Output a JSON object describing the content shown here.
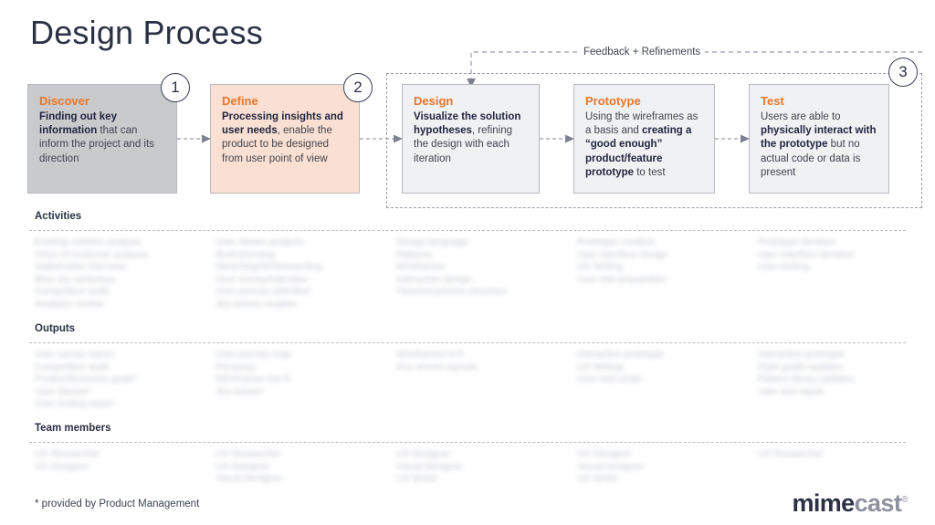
{
  "title": "Design Process",
  "feedback": {
    "label": "Feedback + Refinements"
  },
  "steps": [
    {
      "number": "1"
    },
    {
      "number": "2"
    },
    {
      "number": "3"
    }
  ],
  "phases": [
    {
      "id": "discover",
      "title": "Discover",
      "desc_bold": "Finding out key information",
      "desc_rest": " that can inform the project and its direction",
      "bg_color": "#c9cacc"
    },
    {
      "id": "define",
      "title": "Define",
      "desc_bold": "Processing insights and user needs",
      "desc_rest": ", enable the product to be designed from user point of view",
      "bg_color": "#fae0d2"
    },
    {
      "id": "design",
      "title": "Design",
      "desc_bold": "Visualize the solution hypotheses",
      "desc_rest": ", refining the design with each iteration",
      "bg_color": "#f0f1f2"
    },
    {
      "id": "prototype",
      "title": "Prototype",
      "desc_lead": "Using the wireframes as a basis and ",
      "desc_bold": "creating a “good enough” product/feature prototype",
      "desc_rest": " to test",
      "bg_color": "#f0f1f2"
    },
    {
      "id": "test",
      "title": "Test",
      "desc_lead": "Users are able to ",
      "desc_bold": "physically interact with the prototype",
      "desc_rest": " but no actual code or data is present",
      "bg_color": "#f0f1f2"
    }
  ],
  "sections": [
    {
      "id": "activities",
      "label": "Activities",
      "columns": [
        [
          "Existing solution analysis",
          "Voice of customer analysis",
          "Stakeholder interview",
          "Blue sky workshop",
          "Competitive audit",
          "Analytics review"
        ],
        [
          "User stories analysis",
          "Brainstorming",
          "Sketching/Whiteboarding",
          "User survey/interview",
          "User journey definition",
          "Jira tickets creation"
        ],
        [
          "Design language",
          "Patterns",
          "Wireframes",
          "Interaction design",
          "Taxonomy/menu structure"
        ],
        [
          "Prototype creation",
          "User interface design",
          "UX Writing",
          "User test preparation"
        ],
        [
          "Prototype iteration",
          "User interface iteration",
          "User testing"
        ]
      ]
    },
    {
      "id": "outputs",
      "label": "Outputs",
      "columns": [
        [
          "User survey report",
          "Competitive audit",
          "Product/business goals*",
          "User Stories*",
          "User testing report"
        ],
        [
          "User journey map",
          "Personas",
          "Wireframes low-fi",
          "Jira tickets*"
        ],
        [
          "Wireframes hi-fi",
          "Key screen layouts"
        ],
        [
          "Interactive prototype",
          "UX Writing",
          "User test script"
        ],
        [
          "Interactive prototype",
          "Style guide updates",
          "Pattern library updates",
          "User test report"
        ]
      ]
    },
    {
      "id": "team",
      "label": "Team members",
      "columns": [
        [
          "UX Researcher",
          "UX Designer"
        ],
        [
          "UX Researcher",
          "UX Designer",
          "Visual Designer"
        ],
        [
          "UX Designer",
          "Visual Designer",
          "UX Writer"
        ],
        [
          "UX Designer",
          "Visual Designer",
          "UX Writer"
        ],
        [
          "UX Researcher"
        ]
      ]
    }
  ],
  "footnote": "* provided by Product Management",
  "brand": {
    "part_one": "mime",
    "part_two": "cast",
    "registered": "®"
  },
  "colors": {
    "accent_orange": "#e8762c",
    "navy": "#2b3045",
    "body_text": "#3f4450",
    "rule": "#b9bcc4"
  }
}
